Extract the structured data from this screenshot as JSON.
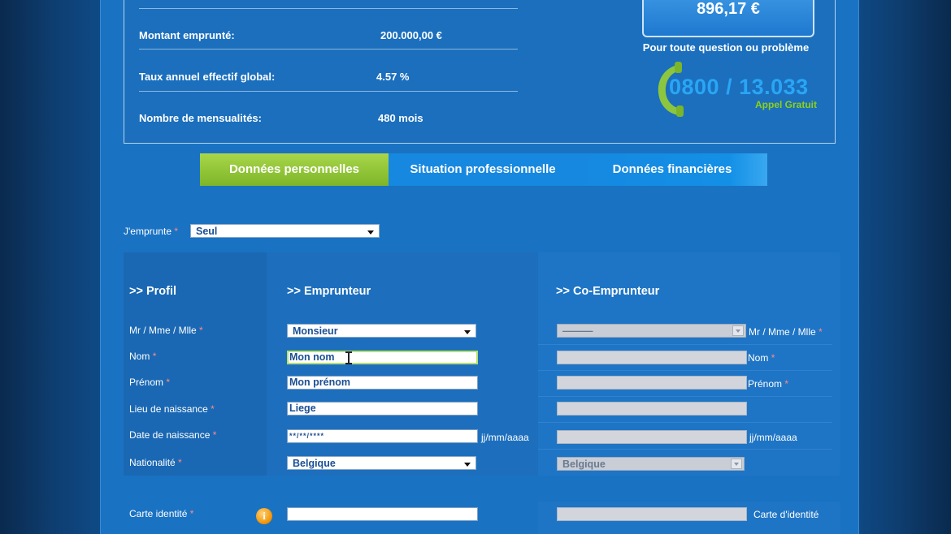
{
  "summary": {
    "rows": [
      {
        "label": "Montant emprunté:",
        "value": "200.000,00 €"
      },
      {
        "label": "Taux annuel effectif global:",
        "value": "4.57 %"
      },
      {
        "label": "Nombre de mensualités:",
        "value": "480 mois"
      }
    ]
  },
  "monthly": {
    "amount": "896,17 €"
  },
  "contact": {
    "question": "Pour toute question ou problème",
    "phone": "0800 / 13.033",
    "free": "Appel Gratuit"
  },
  "tabs": [
    {
      "label": "Données personnelles",
      "active": true
    },
    {
      "label": "Situation professionnelle",
      "active": false
    },
    {
      "label": "Données financières",
      "active": false
    }
  ],
  "borrow": {
    "label": "J'emprunte",
    "required": "*",
    "value": "Seul"
  },
  "headers": {
    "profile": ">> Profil",
    "borrower": ">> Emprunteur",
    "coborrower": ">> Co-Emprunteur"
  },
  "fields": {
    "title": {
      "label": "Mr / Mme / Mlle",
      "value": "Monsieur",
      "co_value": "———"
    },
    "nom": {
      "label": "Nom",
      "value": "Mon nom",
      "co_label": "Nom"
    },
    "prenom": {
      "label": "Prénom",
      "value": "Mon prénom",
      "co_label": "Prénom"
    },
    "lieu": {
      "label": "Lieu de naissance",
      "value": "Liege"
    },
    "date": {
      "label": "Date de naissance",
      "value": "**/**/****",
      "unit": "jj/mm/aaaa"
    },
    "nationalite": {
      "label": "Nationalité",
      "value": "Belgique",
      "co_value": "Belgique"
    },
    "carte": {
      "label": "Carte identité",
      "value": "",
      "co_label": "Carte d'identité"
    }
  },
  "required_mark": "*",
  "colors": {
    "accent_green": "#8cc63f",
    "tab_blue": "#1688e0",
    "phone_blue": "#29a6f5"
  }
}
